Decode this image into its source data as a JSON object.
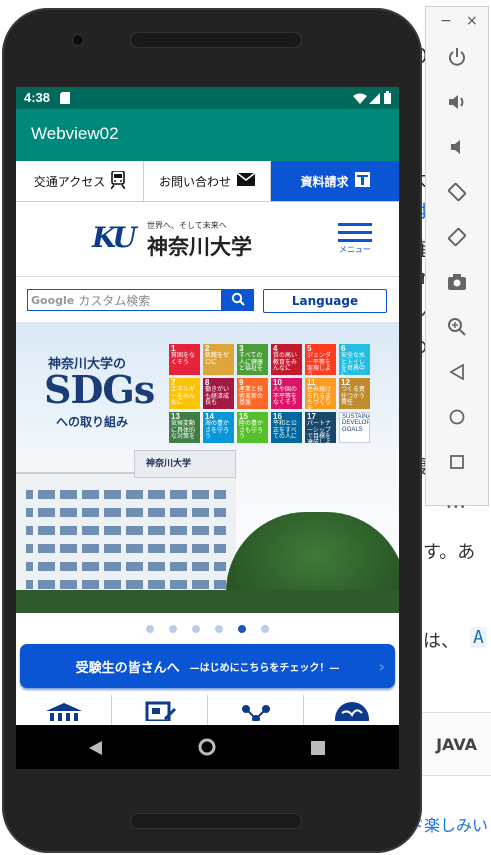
{
  "background_page": {
    "fragments": [
      "O",
      "大",
      "は",
      "確",
      "ar",
      "ン",
      "め",
      "腹",
      "ます。あ",
      "例は、"
    ],
    "code_fragment": "A",
    "tab_label": "JAVA",
    "footer_link": "ド楽しみい"
  },
  "emulator_panel": {
    "minimize_glyph": "−",
    "close_glyph": "×",
    "more_glyph": "•••"
  },
  "status_bar": {
    "time": "4:38"
  },
  "app_bar": {
    "title": "Webview02"
  },
  "top_nav": {
    "access_label": "交通アクセス",
    "contact_label": "お問い合わせ",
    "request_label": "資料請求"
  },
  "header": {
    "logo_mark": "KU",
    "slogan": "世界へ、そして未来へ",
    "university_name": "神奈川大学",
    "menu_label": "メニュー"
  },
  "search": {
    "google_label": "Google",
    "placeholder": "カスタム検索",
    "language_label": "Language"
  },
  "hero": {
    "line1": "神奈川大学の",
    "big": "SDGs",
    "line2": "への取り組み",
    "building_sign": "神奈川大学",
    "sdg_goals": [
      {
        "n": "1",
        "label": "貧困をなくそう",
        "color": "#e5243b"
      },
      {
        "n": "2",
        "label": "飢餓をゼロに",
        "color": "#dda63a"
      },
      {
        "n": "3",
        "label": "すべての人に健康と福祉を",
        "color": "#4c9f38"
      },
      {
        "n": "4",
        "label": "質の高い教育をみんなに",
        "color": "#c5192d"
      },
      {
        "n": "5",
        "label": "ジェンダー平等を実現しよう",
        "color": "#ff3a21"
      },
      {
        "n": "6",
        "label": "安全な水とトイレを世界中に",
        "color": "#26bde2"
      },
      {
        "n": "7",
        "label": "エネルギーをみんなに",
        "color": "#fcc30b"
      },
      {
        "n": "8",
        "label": "働きがいも経済成長も",
        "color": "#a21942"
      },
      {
        "n": "9",
        "label": "産業と技術革新の基盤",
        "color": "#fd6925"
      },
      {
        "n": "10",
        "label": "人や国の不平等をなくそう",
        "color": "#dd1367"
      },
      {
        "n": "11",
        "label": "住み続けられるまちづくりを",
        "color": "#fd9d24"
      },
      {
        "n": "12",
        "label": "つくる責任つかう責任",
        "color": "#bf8b2e"
      },
      {
        "n": "13",
        "label": "気候変動に具体的な対策を",
        "color": "#3f7e44"
      },
      {
        "n": "14",
        "label": "海の豊かさを守ろう",
        "color": "#0a97d9"
      },
      {
        "n": "15",
        "label": "陸の豊かさも守ろう",
        "color": "#56c02b"
      },
      {
        "n": "16",
        "label": "平和と公正をすべての人に",
        "color": "#00689d"
      },
      {
        "n": "17",
        "label": "パートナーシップで目標を達成しよう",
        "color": "#19486a"
      },
      {
        "n": "",
        "label": "SUSTAINABLE DEVELOPMENT GOALS",
        "color": "#ffffff"
      }
    ]
  },
  "carousel": {
    "count": 6,
    "active_index": 4
  },
  "cta": {
    "label": "受験生の皆さんへ",
    "sub": "—はじめにこちらをチェック！—",
    "arrow": "›"
  },
  "colors": {
    "status_bar": "#00695c",
    "app_bar": "#00897b",
    "brand_blue": "#0a55d3",
    "logo_blue": "#0d3a8c"
  }
}
